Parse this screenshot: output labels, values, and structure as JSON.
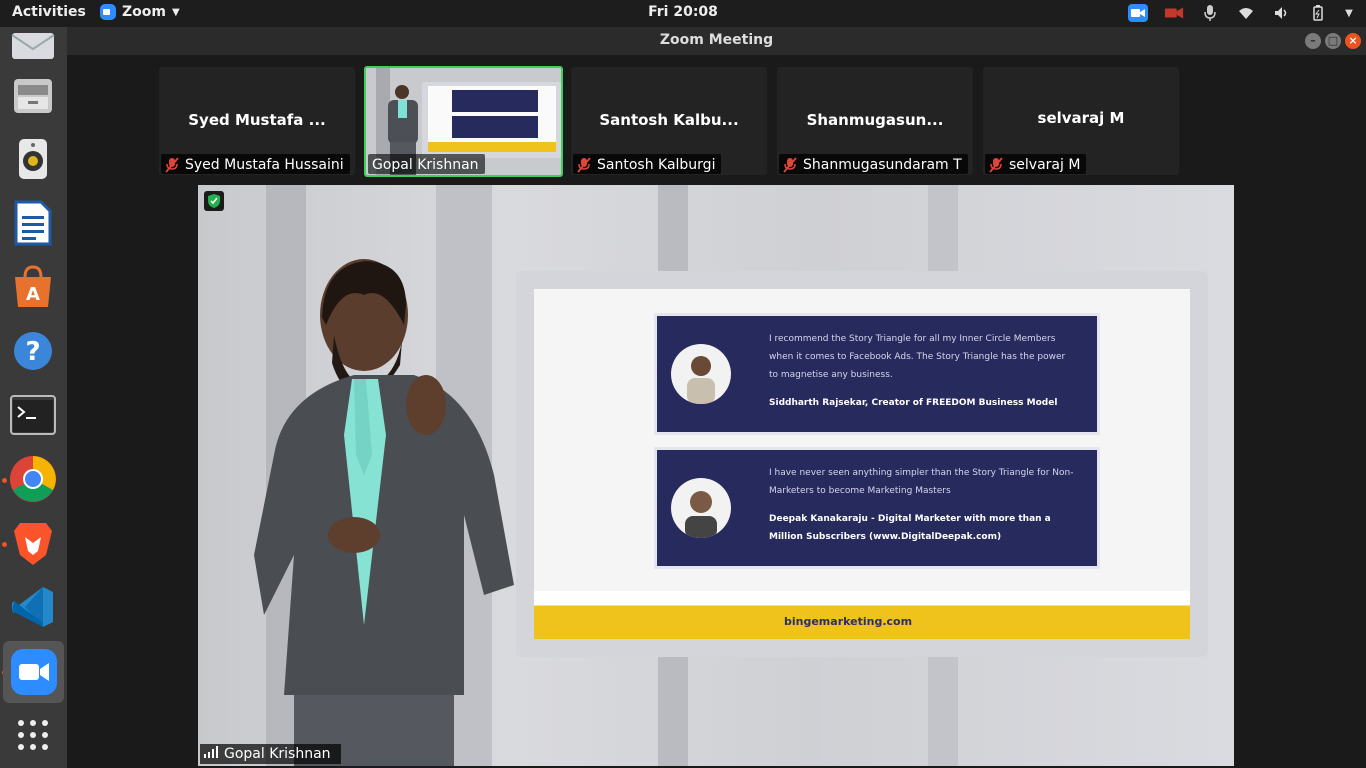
{
  "topbar": {
    "activities": "Activities",
    "app_name": "Zoom",
    "clock": "Fri 20:08"
  },
  "window": {
    "title": "Zoom Meeting"
  },
  "thumbnails": [
    {
      "display_name": "Syed Mustafa ...",
      "label": "Syed Mustafa Hussaini",
      "muted": true
    },
    {
      "display_name": "",
      "label": "Gopal Krishnan",
      "muted": false,
      "active_speaker": true
    },
    {
      "display_name": "Santosh Kalbu...",
      "label": "Santosh Kalburgi",
      "muted": true
    },
    {
      "display_name": "Shanmugasun...",
      "label": "Shanmugasundaram T",
      "muted": true
    },
    {
      "display_name": "selvaraj M",
      "label": "selvaraj M",
      "muted": true
    }
  ],
  "main_video": {
    "speaker": "Gopal Krishnan",
    "slide": {
      "testimonials": [
        {
          "quote": "I recommend the Story Triangle for all my Inner Circle Members when it comes to Facebook Ads. The Story Triangle has the power to magnetise any business.",
          "author": "Siddharth Rajsekar, Creator of FREEDOM Business Model"
        },
        {
          "quote": "I have never seen anything simpler than the Story Triangle for Non-Marketers to become Marketing Masters",
          "author": "Deepak Kanakaraju - Digital Marketer with more than a Million Subscribers (www.DigitalDeepak.com)"
        }
      ],
      "footer_brand": "bingemarketing.com"
    }
  },
  "colors": {
    "zoom_blue": "#2d8cff",
    "active_border": "#3fcf5c",
    "mute_red": "#e0453a",
    "slide_navy": "#272a5c",
    "slide_yellow": "#f0c21c"
  }
}
